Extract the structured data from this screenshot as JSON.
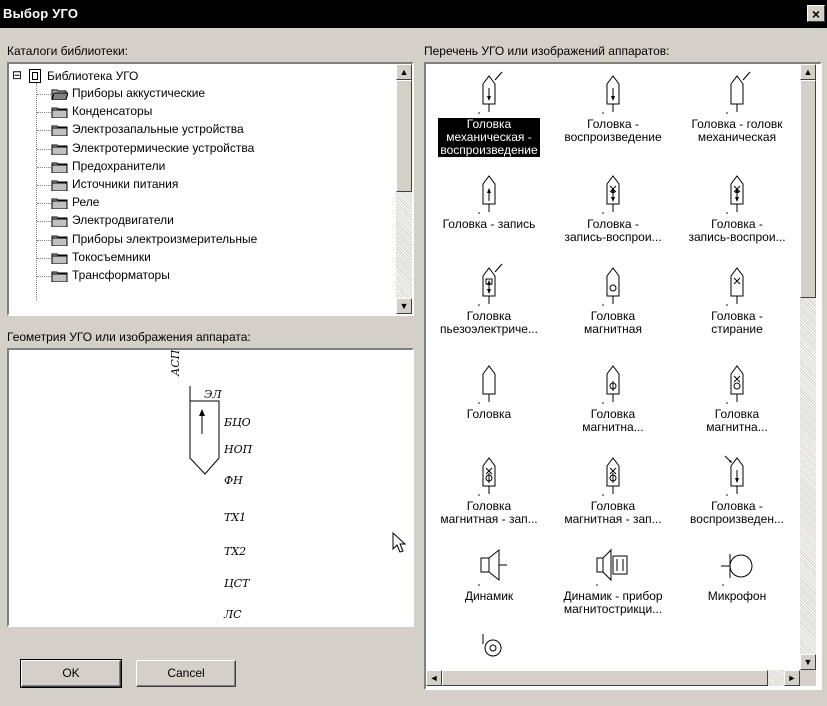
{
  "window": {
    "title": "Выбор УГО",
    "close_symbol": "×"
  },
  "labels": {
    "catalogs": "Каталоги библиотеки:",
    "symbols_list": "Перечень УГО или изображений аппаратов:",
    "geometry": "Геометрия УГО или изображения аппарата:"
  },
  "tree": {
    "root": {
      "label": "Библиотека УГО",
      "expander": "⊟",
      "icon": "book-icon"
    },
    "items": [
      {
        "label": "Приборы аккустические",
        "icon": "folder-open-icon"
      },
      {
        "label": "Конденсаторы",
        "icon": "folder-icon"
      },
      {
        "label": "Электрозапальные устройства",
        "icon": "folder-icon"
      },
      {
        "label": "Электротермические устройства",
        "icon": "folder-icon"
      },
      {
        "label": "Предохранители",
        "icon": "folder-icon"
      },
      {
        "label": "Источники питания",
        "icon": "folder-icon"
      },
      {
        "label": "Реле",
        "icon": "folder-icon"
      },
      {
        "label": "Электродвигатели",
        "icon": "folder-icon"
      },
      {
        "label": "Приборы электроизмерительные",
        "icon": "folder-icon"
      },
      {
        "label": "Токосъемники",
        "icon": "folder-icon"
      },
      {
        "label": "Трансформаторы",
        "icon": "folder-icon"
      }
    ]
  },
  "symbols": [
    {
      "lines": [
        "Головка",
        "механическая -",
        "воспроизведение"
      ],
      "selected": true,
      "icon": "head-mechanical-playback-icon"
    },
    {
      "lines": [
        "Головка -",
        "воспроизведение"
      ],
      "icon": "head-playback-icon"
    },
    {
      "lines": [
        "Головка - головк",
        "механическая"
      ],
      "icon": "head-mechanical-icon"
    },
    {
      "lines": [
        "Головка - запись"
      ],
      "icon": "head-record-icon"
    },
    {
      "lines": [
        "Головка -",
        "запись-воспрои..."
      ],
      "icon": "head-record-playback-icon"
    },
    {
      "lines": [
        "Головка -",
        "запись-воспрои..."
      ],
      "icon": "head-record-playback-2-icon"
    },
    {
      "lines": [
        "Головка",
        "пьезоэлектриче..."
      ],
      "icon": "head-piezo-icon"
    },
    {
      "lines": [
        "Головка",
        "магнитная"
      ],
      "icon": "head-magnetic-icon"
    },
    {
      "lines": [
        "Головка -",
        "стирание"
      ],
      "icon": "head-erase-icon"
    },
    {
      "lines": [
        "Головка"
      ],
      "icon": "head-icon"
    },
    {
      "lines": [
        "Головка",
        "магнитна..."
      ],
      "icon": "head-magnetic-2-icon"
    },
    {
      "lines": [
        "Головка",
        "магнитна..."
      ],
      "icon": "head-magnetic-3-icon"
    },
    {
      "lines": [
        "Головка",
        "магнитная - зап..."
      ],
      "icon": "head-magnetic-record-icon"
    },
    {
      "lines": [
        "Головка",
        "магнитная - зап..."
      ],
      "icon": "head-magnetic-record-2-icon"
    },
    {
      "lines": [
        "Головка -",
        "воспроизведен..."
      ],
      "icon": "head-playback-2-icon"
    },
    {
      "lines": [
        "Динамик"
      ],
      "icon": "speaker-icon"
    },
    {
      "lines": [
        "Динамик - прибор",
        "магнитострикци..."
      ],
      "icon": "speaker-magnetostrictive-icon"
    },
    {
      "lines": [
        "Микрофон"
      ],
      "icon": "microphone-icon"
    },
    {
      "lines": [],
      "icon": "partial-symbol-icon"
    }
  ],
  "geometry": {
    "labels": [
      "АСП",
      "ЭЛ",
      "БЦО",
      "НОП",
      "ФН",
      "ТХ1",
      "ТХ2",
      "ЦСТ",
      "ЛС"
    ]
  },
  "scroll_arrows": {
    "up": "▲",
    "down": "▼",
    "left": "◄",
    "right": "►"
  },
  "buttons": {
    "ok": "OK",
    "cancel": "Cancel"
  }
}
